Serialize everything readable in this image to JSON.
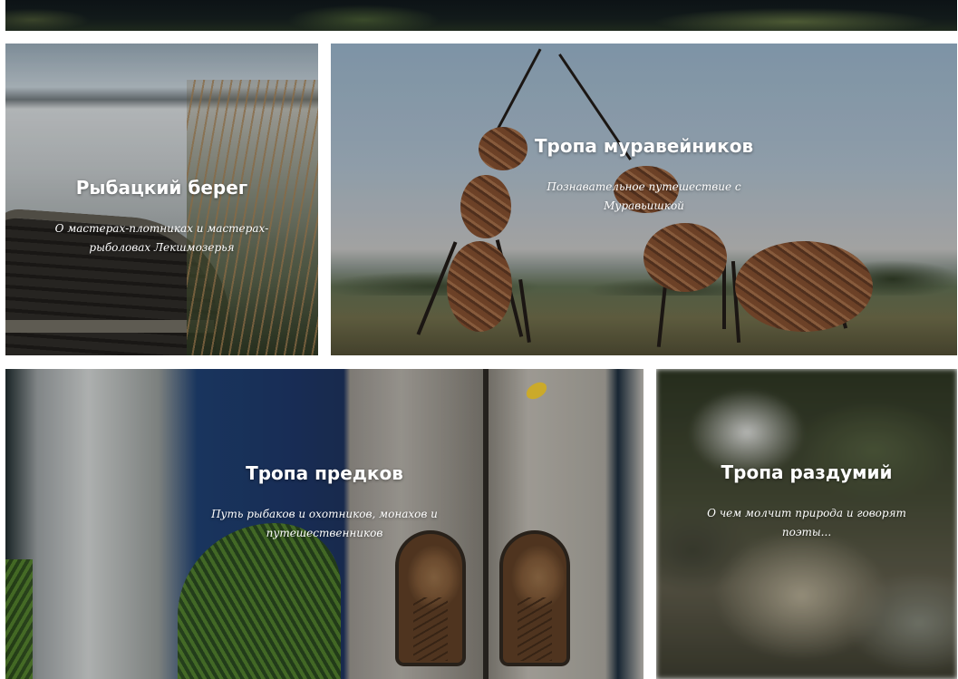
{
  "tiles": [
    {
      "title": "Рыбацкий берег",
      "description": "О мастерах-плотниках и мастерах-рыболовах Лекшмозерья"
    },
    {
      "title": "Тропа муравейников",
      "description": "Познавательное путешествие с Муравьишкой"
    },
    {
      "title": "Тропа предков",
      "description": "Путь рыбаков и охотников, монахов и путешественников"
    },
    {
      "title": "Тропа раздумий",
      "description": "О чем молчит природа и говорят поэты..."
    }
  ],
  "colors": {
    "page_background": "#ffffff",
    "caption_text": "#ffffff",
    "leaf_accent": "#e8c230"
  }
}
